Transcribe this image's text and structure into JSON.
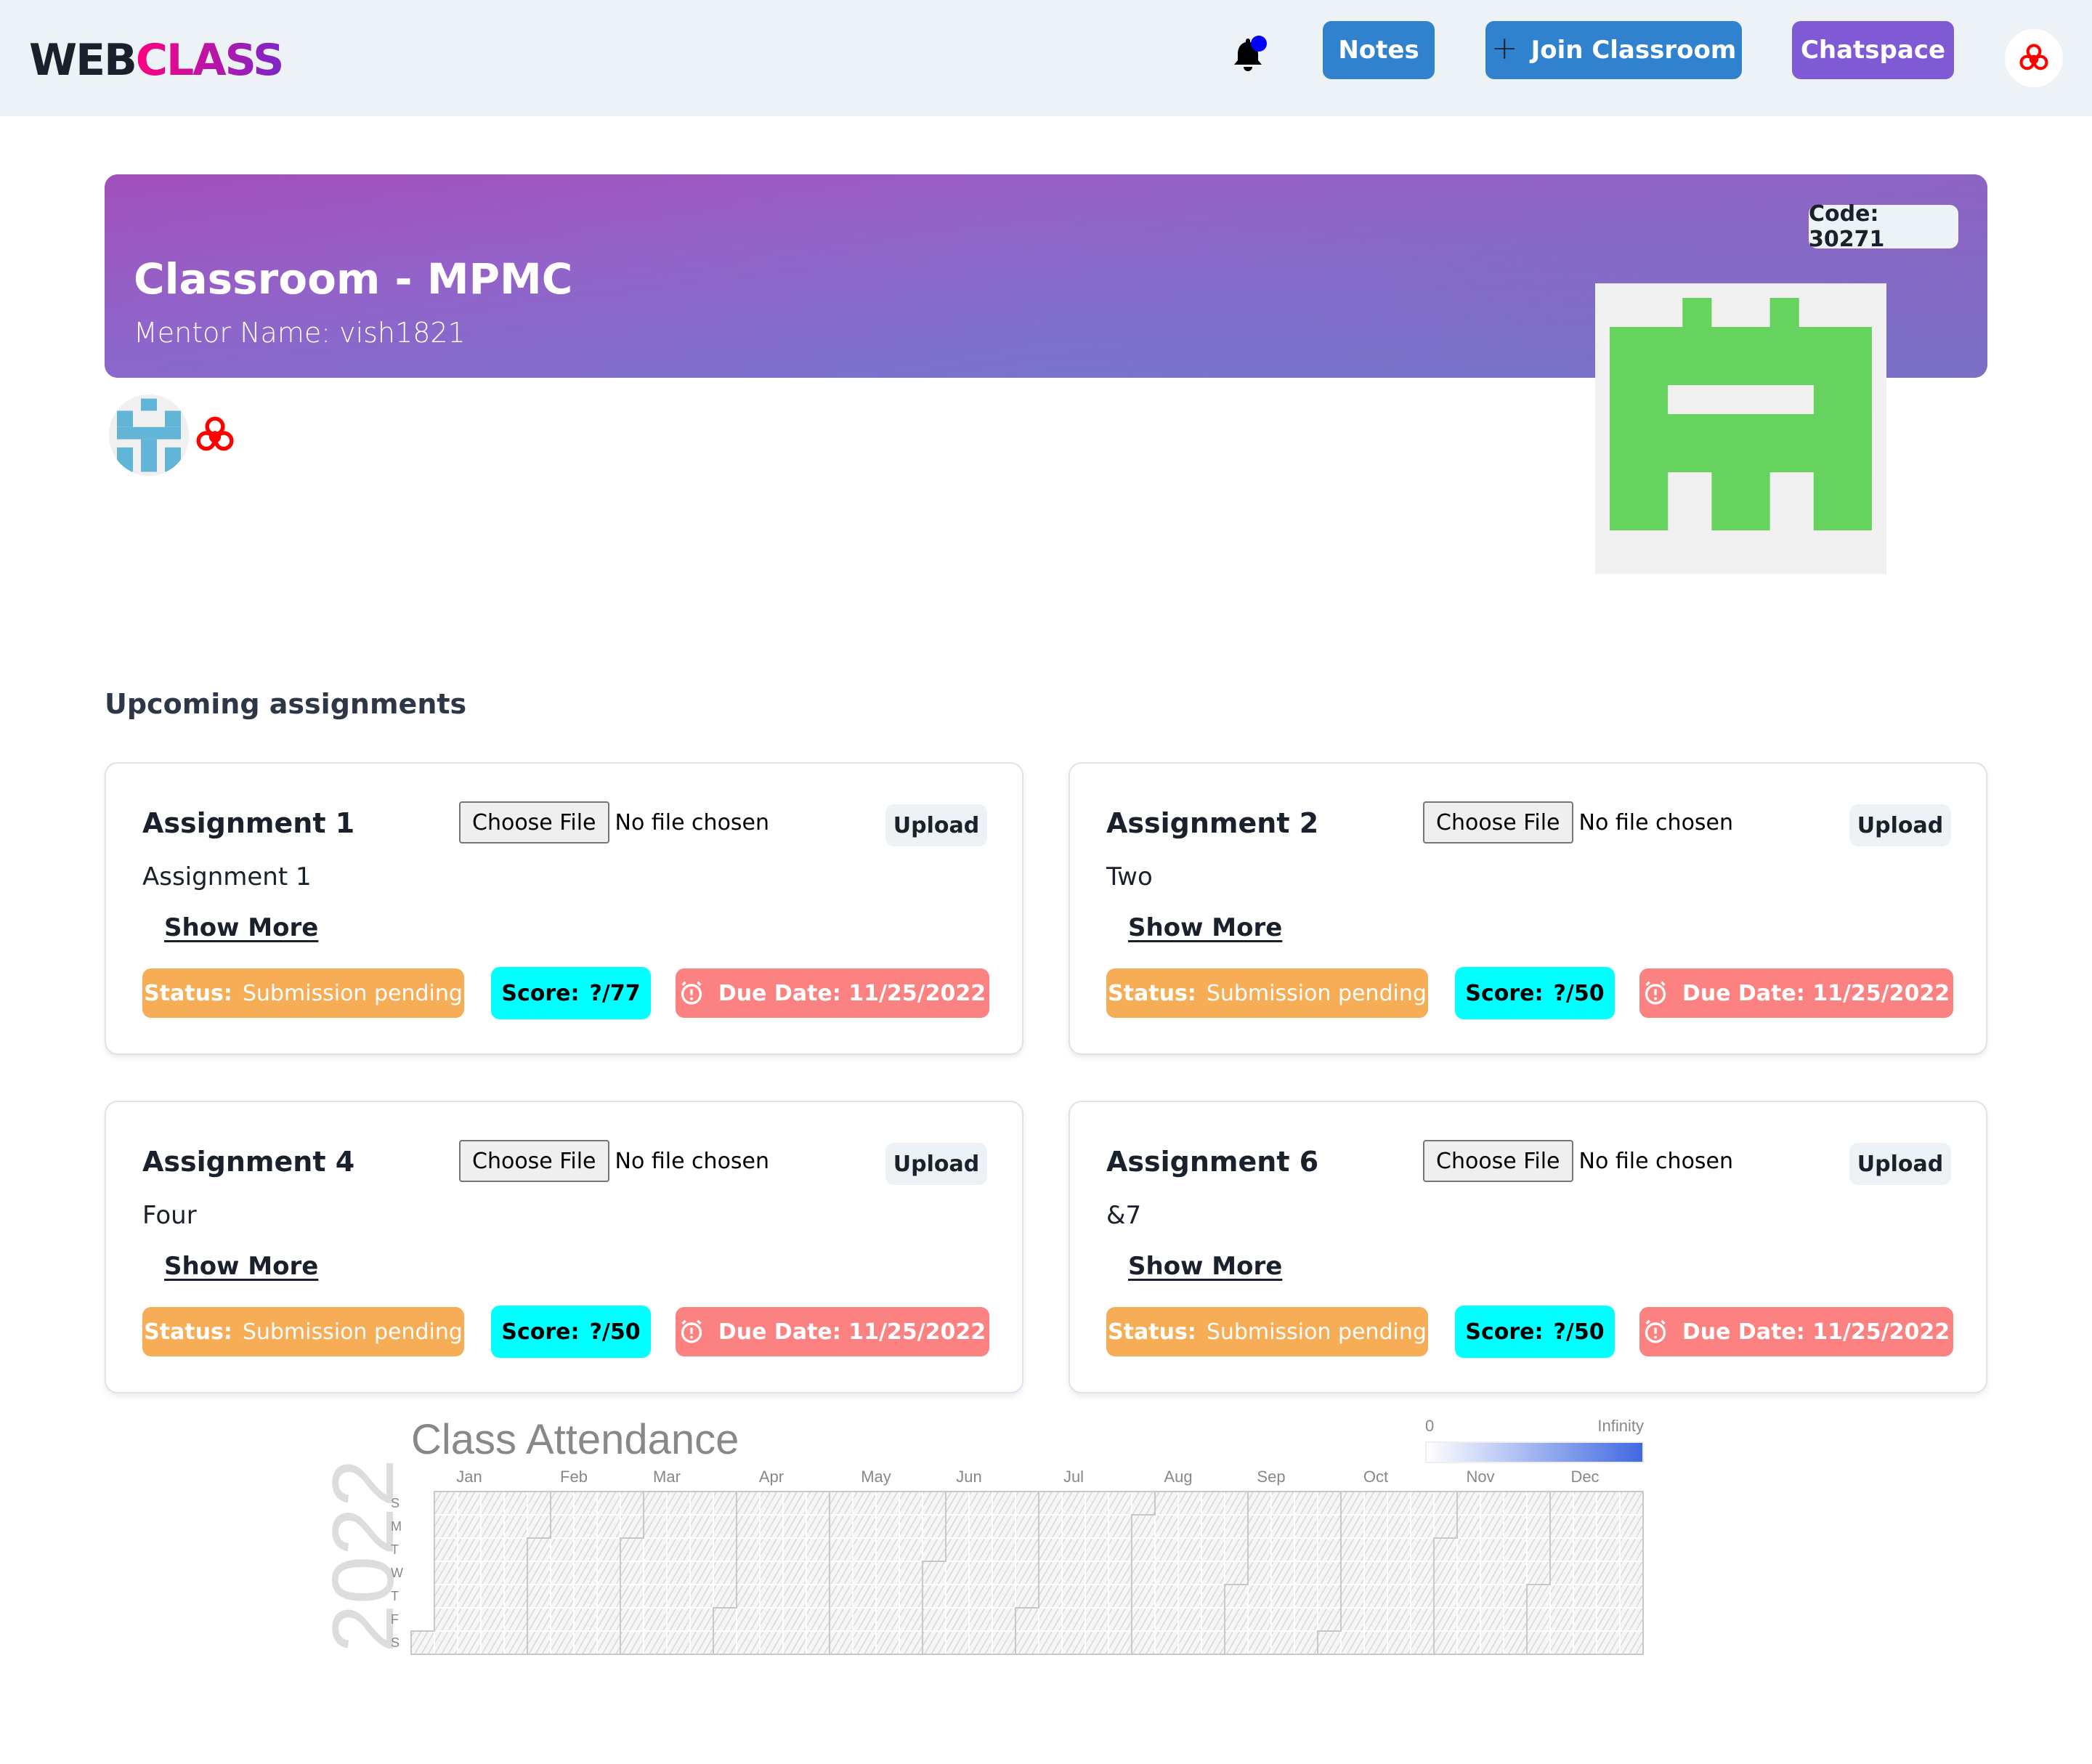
{
  "header": {
    "logo_part1": "WEB",
    "logo_part2": "CLASS",
    "notification_icon": "bell-icon",
    "notes_label": "Notes",
    "join_label": "Join Classroom",
    "join_icon": "plus-icon",
    "chatspace_label": "Chatspace",
    "user_avatar_icon": "biohazard-icon",
    "colors": {
      "notes": "#3182ce",
      "join": "#3182ce",
      "chatspace": "#805ad5",
      "notification_dot": "#0000ff"
    }
  },
  "classroom": {
    "title": "Classroom - MPMC",
    "mentor": "Mentor Name: vish1821",
    "code": "Code: 30271",
    "identicon_color": "#65d35e",
    "members": [
      {
        "avatar": "identicon",
        "color": "#63b5d8"
      },
      {
        "avatar": "biohazard-icon",
        "color": "#ff0000"
      }
    ]
  },
  "assignments": {
    "heading": "Upcoming assignments",
    "choose_file_label": "Choose File",
    "no_file_label": "No file chosen",
    "upload_label": "Upload",
    "show_more_label": "Show More",
    "status_label": "Status:",
    "score_label": "Score:",
    "items": [
      {
        "title": "Assignment 1",
        "description": "Assignment 1",
        "status": "Submission pending",
        "score": "?/77",
        "due": "Due Date: 11/25/2022"
      },
      {
        "title": "Assignment 2",
        "description": "Two",
        "status": "Submission pending",
        "score": "?/50",
        "due": "Due Date: 11/25/2022"
      },
      {
        "title": "Assignment 4",
        "description": "Four",
        "status": "Submission pending",
        "score": "?/50",
        "due": "Due Date: 11/25/2022"
      },
      {
        "title": "Assignment 6",
        "description": "&7",
        "status": "Submission pending",
        "score": "?/50",
        "due": "Due Date: 11/25/2022"
      }
    ],
    "colors": {
      "status": "#f6ad55",
      "score": "#00ffff",
      "due": "#fc8181"
    }
  },
  "chart_data": {
    "type": "heatmap",
    "title": "Class Attendance",
    "year": "2022",
    "legend": {
      "min_label": "0",
      "max_label": "Infinity",
      "min_color": "#ffffff",
      "max_color": "#4169e1",
      "placement": "top-right"
    },
    "month_labels": [
      "Jan",
      "Feb",
      "Mar",
      "Apr",
      "May",
      "Jun",
      "Jul",
      "Aug",
      "Sep",
      "Oct",
      "Nov",
      "Dec"
    ],
    "day_labels": [
      "S",
      "M",
      "T",
      "W",
      "T",
      "F",
      "S"
    ],
    "start_date": "2022-01-01",
    "end_date": "2022-12-31",
    "values": []
  }
}
